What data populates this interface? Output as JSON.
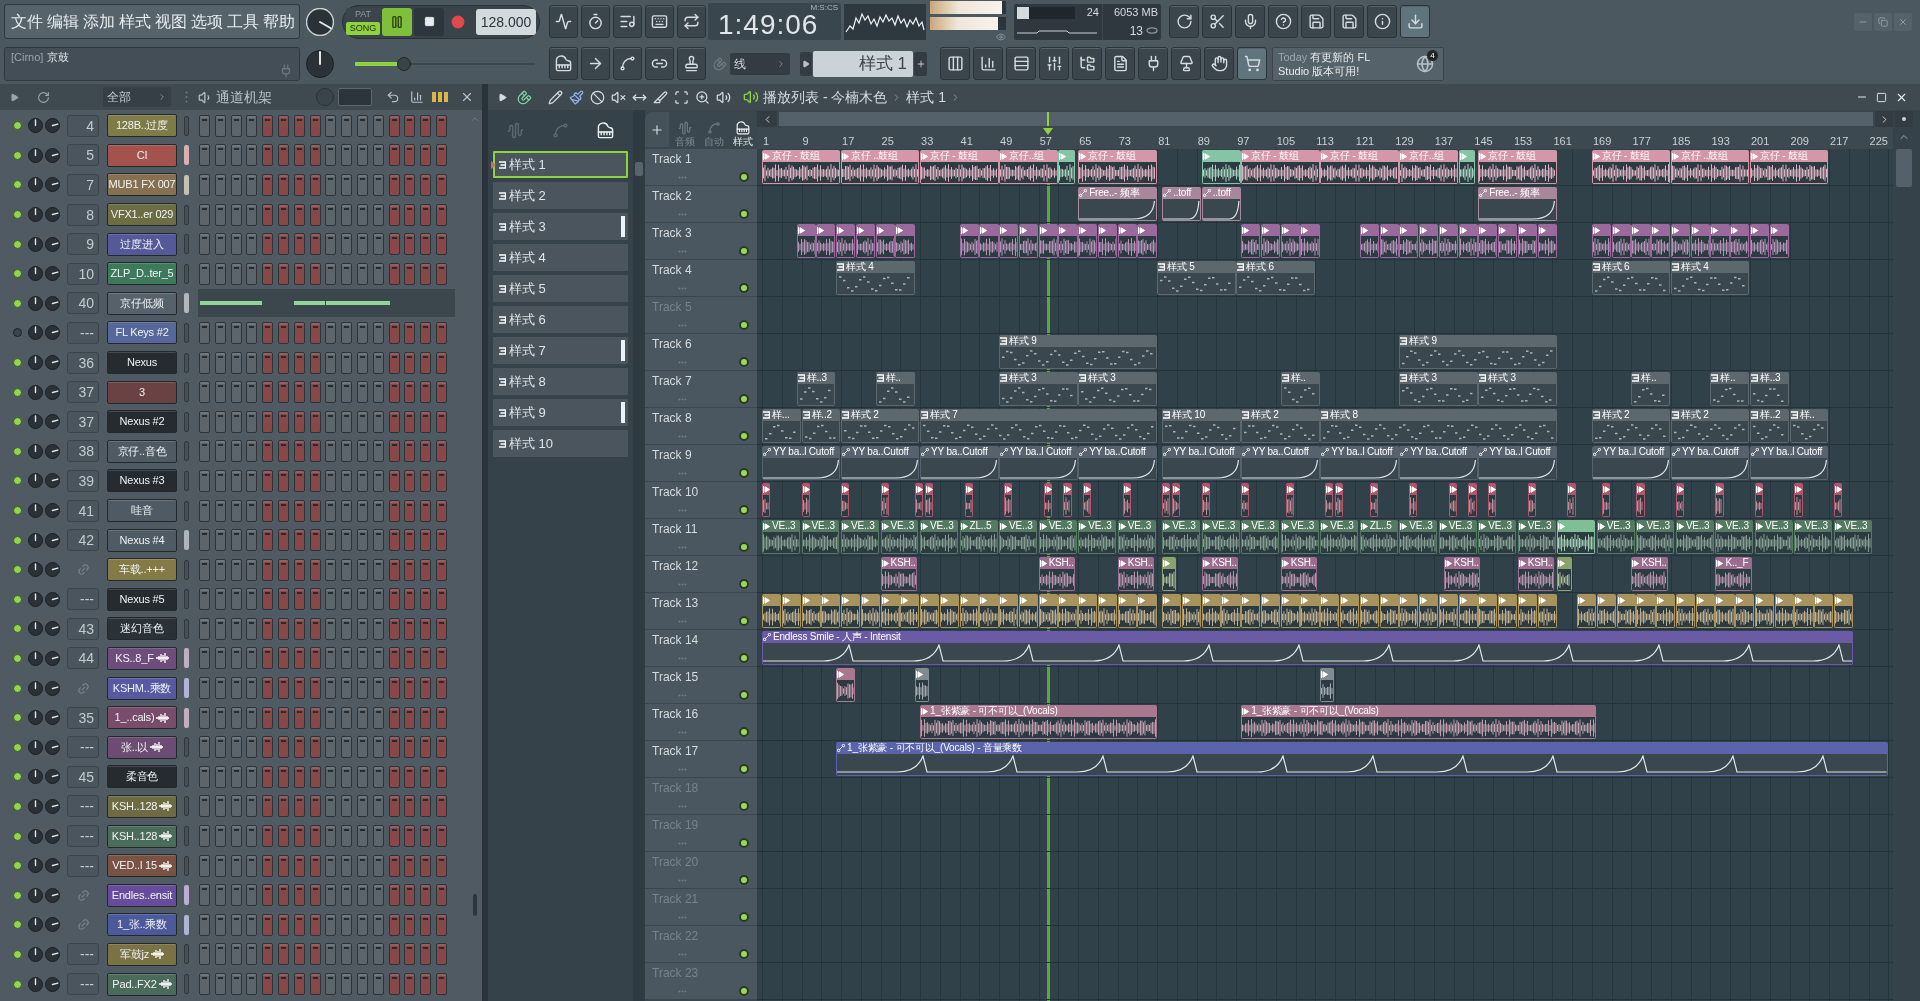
{
  "menu": [
    "文件",
    "编辑",
    "添加",
    "样式",
    "视图",
    "选项",
    "工具",
    "帮助"
  ],
  "hint": {
    "prefix": "[Cirno]",
    "text": "京鼓"
  },
  "song_position": {
    "level": 0.27
  },
  "transport": {
    "modes": [
      {
        "label": "PAT",
        "selected": false
      },
      {
        "label": "SONG",
        "selected": true
      }
    ],
    "playing": true,
    "tempo": "128.000"
  },
  "time": {
    "unit": "M:S:CS",
    "value": "1:49:06"
  },
  "peak_meters": [
    {
      "level": 0.95
    },
    {
      "level": 0.9
    }
  ],
  "cpu": {
    "level": 0.2,
    "reading": "24"
  },
  "memory": "6053 MB",
  "polyphony": "13",
  "snap": "线",
  "pattern_selector": "样式 1",
  "news": {
    "label": "Today",
    "message": "有更新的 FL Studio 版本可用!",
    "badge": "4"
  },
  "channel_rack": {
    "filter": "全部",
    "title": "通道机架",
    "channels": [
      {
        "enabled": true,
        "kind": "instrument",
        "mixer": "4",
        "name": "128B..过度",
        "color": "#7e7c46",
        "selected": false
      },
      {
        "enabled": true,
        "kind": "instrument",
        "mixer": "5",
        "name": "CI",
        "color": "#a4524c",
        "selected": true
      },
      {
        "enabled": true,
        "kind": "instrument",
        "mixer": "7",
        "name": "MUB1 FX 007",
        "color": "#85704f",
        "selected": true
      },
      {
        "enabled": true,
        "kind": "instrument",
        "mixer": "8",
        "name": "VFX1..er 029",
        "color": "#6c6d43",
        "selected": false
      },
      {
        "enabled": true,
        "kind": "instrument",
        "mixer": "9",
        "name": "过度进入",
        "color": "#55599a",
        "selected": false
      },
      {
        "enabled": true,
        "kind": "instrument",
        "mixer": "10",
        "name": "ZLP_D..ter_5",
        "color": "#3d7a5c",
        "selected": false
      },
      {
        "enabled": true,
        "kind": "pianoroll",
        "mixer": "40",
        "name": "京仔低频",
        "color": "#56626b",
        "selected": true
      },
      {
        "enabled": false,
        "kind": "instrument",
        "mixer": "---",
        "name": "FL Keys #2",
        "color": "#56679a",
        "selected": false
      },
      {
        "enabled": true,
        "kind": "instrument",
        "mixer": "36",
        "name": "Nexus",
        "color": "#262b2f",
        "selected": false
      },
      {
        "enabled": true,
        "kind": "instrument",
        "mixer": "37",
        "name": "3",
        "color": "#6a4244",
        "selected": false
      },
      {
        "enabled": true,
        "kind": "instrument",
        "mixer": "37",
        "name": "Nexus #2",
        "color": "#262b2f",
        "selected": false
      },
      {
        "enabled": true,
        "kind": "instrument",
        "mixer": "38",
        "name": "京仔..音色",
        "color": "#4f5b64",
        "selected": false
      },
      {
        "enabled": true,
        "kind": "instrument",
        "mixer": "39",
        "name": "Nexus #3",
        "color": "#262b2f",
        "selected": false
      },
      {
        "enabled": true,
        "kind": "instrument",
        "mixer": "41",
        "name": "哇音",
        "color": "#4f5b64",
        "selected": false
      },
      {
        "enabled": true,
        "kind": "instrument",
        "mixer": "42",
        "name": "Nexus #4",
        "color": "#4f5b64",
        "selected": true
      },
      {
        "enabled": true,
        "kind": "automation",
        "name": "车载..+++",
        "color": "#847a45",
        "selected": false
      },
      {
        "enabled": true,
        "kind": "instrument",
        "mixer": "---",
        "name": "Nexus #5",
        "color": "#262b2f",
        "selected": false
      },
      {
        "enabled": true,
        "kind": "instrument",
        "mixer": "43",
        "name": "迷幻音色",
        "color": "#2b3237",
        "selected": false
      },
      {
        "enabled": true,
        "kind": "audio",
        "mixer": "44",
        "name": "KS..8_F",
        "color": "#6e4c7c",
        "selected": true
      },
      {
        "enabled": true,
        "kind": "automation",
        "name": "KSHM..乘数",
        "color": "#5659a0",
        "selected": true
      },
      {
        "enabled": true,
        "kind": "audio",
        "mixer": "35",
        "name": "1_..cals)",
        "color": "#7a4c6c",
        "selected": true
      },
      {
        "enabled": true,
        "kind": "audio",
        "mixer": "---",
        "name": "张..以",
        "color": "#6c4c72",
        "selected": false
      },
      {
        "enabled": true,
        "kind": "instrument",
        "mixer": "45",
        "name": "柔音色",
        "color": "#262b2f",
        "selected": false
      },
      {
        "enabled": true,
        "kind": "audio",
        "mixer": "---",
        "name": "KSH..128",
        "color": "#6e6b42",
        "selected": false
      },
      {
        "enabled": true,
        "kind": "audio",
        "mixer": "---",
        "name": "KSH..128",
        "color": "#4b6b5b",
        "selected": false
      },
      {
        "enabled": true,
        "kind": "audio",
        "mixer": "---",
        "name": "VED..l 15",
        "color": "#7a5244",
        "selected": false
      },
      {
        "enabled": true,
        "kind": "automation",
        "name": "Endles..ensit",
        "color": "#684c9c",
        "selected": true
      },
      {
        "enabled": true,
        "kind": "automation",
        "name": "1_张..乘数",
        "color": "#4c5a9c",
        "selected": true
      },
      {
        "enabled": true,
        "kind": "audio",
        "mixer": "---",
        "name": "军鼓jz",
        "color": "#7a7244",
        "selected": false
      },
      {
        "enabled": true,
        "kind": "audio",
        "mixer": "---",
        "name": "Pad..FX2",
        "color": "#4b6b5a",
        "selected": false
      }
    ]
  },
  "playlist": {
    "title": "播放列表 - 今楠木色",
    "pattern": "样式 1",
    "filters": [
      {
        "label": "音频",
        "selected": false
      },
      {
        "label": "自动",
        "selected": false
      },
      {
        "label": "样式",
        "selected": true
      }
    ],
    "patterns": [
      {
        "label": "样式 1",
        "selected": true,
        "highlighted": false
      },
      {
        "label": "样式 2",
        "selected": false,
        "highlighted": false
      },
      {
        "label": "样式 3",
        "selected": false,
        "highlighted": true
      },
      {
        "label": "样式 4",
        "selected": false,
        "highlighted": false
      },
      {
        "label": "样式 5",
        "selected": false,
        "highlighted": false
      },
      {
        "label": "样式 6",
        "selected": false,
        "highlighted": false
      },
      {
        "label": "样式 7",
        "selected": false,
        "highlighted": true
      },
      {
        "label": "样式 8",
        "selected": false,
        "highlighted": false
      },
      {
        "label": "样式 9",
        "selected": false,
        "highlighted": true
      },
      {
        "label": "样式 10",
        "selected": false,
        "highlighted": false
      }
    ],
    "ruler": [
      "1",
      "9",
      "17",
      "25",
      "33",
      "41",
      "49",
      "57",
      "65",
      "73",
      "81",
      "89",
      "97",
      "105",
      "113",
      "121",
      "129",
      "137",
      "145",
      "153",
      "161",
      "169",
      "177",
      "185",
      "193",
      "201",
      "209",
      "217",
      "225"
    ],
    "tracks": [
      {
        "name": "Track 1",
        "empty": false,
        "color": "#d497aa",
        "clips": [
          {
            "kind": "audio",
            "label": "京仔 - 鼓组"
          },
          {
            "kind": "audio",
            "label": "京仔 ..鼓组"
          },
          {
            "kind": "audio",
            "label": "京仔 - 鼓组"
          },
          {
            "kind": "audio",
            "label": "京仔..组"
          },
          {
            "kind": "audio",
            "color": "#86c4a6"
          },
          {
            "kind": "audio",
            "label": "京仔 - 鼓组"
          },
          {
            "kind": "audio",
            "color": "#86c4a6"
          },
          {
            "kind": "audio",
            "label": "京仔 - 鼓组"
          },
          {
            "kind": "audio",
            "label": "京仔 - 鼓组"
          },
          {
            "kind": "audio",
            "label": "京仔..组"
          },
          {
            "kind": "audio",
            "color": "#86c4a6"
          },
          {
            "kind": "audio",
            "label": "京仔 - 鼓组"
          },
          {
            "kind": "audio",
            "label": "京仔 - 鼓组"
          },
          {
            "kind": "audio",
            "label": "京仔 ..鼓组"
          },
          {
            "kind": "audio",
            "label": "京仔 - 鼓组"
          }
        ]
      },
      {
        "name": "Track 2",
        "empty": false,
        "color": "#a8879c",
        "clips": [
          {
            "kind": "automation",
            "label": "Free..- 频率"
          },
          {
            "kind": "automation",
            "label": "..toff"
          },
          {
            "kind": "automation",
            "label": "..toff"
          },
          {
            "kind": "automation",
            "label": "Free..- 频率"
          }
        ]
      },
      {
        "name": "Track 3",
        "empty": false,
        "color": "#9a6a9c",
        "clips": [
          {
            "kind": "audio"
          },
          {
            "kind": "audio"
          },
          {
            "kind": "audio"
          },
          {
            "kind": "audio"
          },
          {
            "kind": "audio"
          },
          {
            "kind": "audio"
          },
          {
            "kind": "audio"
          },
          {
            "kind": "audio"
          },
          {
            "kind": "audio"
          },
          {
            "kind": "audio"
          },
          {
            "kind": "audio"
          },
          {
            "kind": "audio"
          },
          {
            "kind": "audio"
          },
          {
            "kind": "audio"
          },
          {
            "kind": "audio"
          },
          {
            "kind": "audio"
          },
          {
            "kind": "audio"
          },
          {
            "kind": "audio"
          },
          {
            "kind": "audio"
          },
          {
            "kind": "audio"
          },
          {
            "kind": "audio"
          },
          {
            "kind": "audio"
          },
          {
            "kind": "audio"
          },
          {
            "kind": "audio"
          },
          {
            "kind": "audio"
          },
          {
            "kind": "audio"
          },
          {
            "kind": "audio"
          },
          {
            "kind": "audio"
          },
          {
            "kind": "audio"
          },
          {
            "kind": "audio"
          },
          {
            "kind": "audio"
          },
          {
            "kind": "audio"
          },
          {
            "kind": "audio"
          },
          {
            "kind": "audio"
          },
          {
            "kind": "audio"
          },
          {
            "kind": "audio"
          },
          {
            "kind": "audio"
          },
          {
            "kind": "audio"
          },
          {
            "kind": "audio"
          },
          {
            "kind": "audio"
          }
        ]
      },
      {
        "name": "Track 4",
        "empty": false,
        "color": "#5c676e",
        "clips": [
          {
            "kind": "pattern",
            "label": "样式 4"
          },
          {
            "kind": "pattern",
            "label": "样式 5"
          },
          {
            "kind": "pattern",
            "label": "样式 6"
          },
          {
            "kind": "pattern",
            "label": "样式 6"
          },
          {
            "kind": "pattern",
            "label": "样式 4"
          }
        ]
      },
      {
        "name": "Track 5",
        "empty": true
      },
      {
        "name": "Track 6",
        "empty": false,
        "color": "#5c676e",
        "clips": [
          {
            "kind": "pattern",
            "label": "样式 9"
          },
          {
            "kind": "pattern",
            "label": "样式 9"
          }
        ]
      },
      {
        "name": "Track 7",
        "empty": false,
        "color": "#5c676e",
        "clips": [
          {
            "kind": "pattern",
            "label": "样..3"
          },
          {
            "kind": "pattern",
            "label": "样.."
          },
          {
            "kind": "pattern",
            "label": "样式 3"
          },
          {
            "kind": "pattern",
            "label": "样式 3"
          },
          {
            "kind": "pattern",
            "label": "样.."
          },
          {
            "kind": "pattern",
            "label": "样式 3"
          },
          {
            "kind": "pattern",
            "label": "样式 3"
          },
          {
            "kind": "pattern",
            "label": "样.."
          },
          {
            "kind": "pattern",
            "label": "样.."
          },
          {
            "kind": "pattern",
            "label": "样..3"
          }
        ]
      },
      {
        "name": "Track 8",
        "empty": false,
        "color": "#5c676e",
        "clips": [
          {
            "kind": "pattern",
            "label": "样..."
          },
          {
            "kind": "pattern",
            "label": "样..2"
          },
          {
            "kind": "pattern",
            "label": "样式 2"
          },
          {
            "kind": "pattern",
            "label": "样式 7"
          },
          {
            "kind": "pattern",
            "label": "样式 10"
          },
          {
            "kind": "pattern",
            "label": "样式 2"
          },
          {
            "kind": "pattern",
            "label": "样式 8"
          },
          {
            "kind": "pattern",
            "label": "样式 2"
          },
          {
            "kind": "pattern",
            "label": "样式 2"
          },
          {
            "kind": "pattern",
            "label": "样..2"
          },
          {
            "kind": "pattern",
            "label": "样.."
          }
        ]
      },
      {
        "name": "Track 9",
        "empty": false,
        "color": "#56636e",
        "clips": [
          {
            "kind": "automation",
            "label": "YY ba..l Cutoff"
          },
          {
            "kind": "automation",
            "label": "YY ba..Cutoff"
          },
          {
            "kind": "automation",
            "label": "YY ba..Cutoff"
          },
          {
            "kind": "automation",
            "label": "YY ba..l Cutoff"
          },
          {
            "kind": "automation",
            "label": "YY ba..Cutoff"
          },
          {
            "kind": "automation",
            "label": "YY ba..l Cutoff"
          },
          {
            "kind": "automation",
            "label": "YY ba..Cutoff"
          },
          {
            "kind": "automation",
            "label": "YY ba..l Cutoff"
          },
          {
            "kind": "automation",
            "label": "YY ba..Cutoff"
          },
          {
            "kind": "automation",
            "label": "YY ba..l Cutoff"
          },
          {
            "kind": "automation",
            "label": "YY ba..l Cutoff"
          },
          {
            "kind": "automation",
            "label": "YY ba..Cutoff"
          },
          {
            "kind": "automation",
            "label": "YY ba..l Cutoff"
          }
        ]
      },
      {
        "name": "Track 10",
        "empty": false,
        "color": "#b0566a",
        "clips": [
          {
            "kind": "audio"
          },
          {
            "kind": "audio"
          },
          {
            "kind": "audio"
          },
          {
            "kind": "audio"
          },
          {
            "kind": "audio"
          },
          {
            "kind": "audio"
          },
          {
            "kind": "audio"
          },
          {
            "kind": "audio"
          },
          {
            "kind": "audio"
          },
          {
            "kind": "audio"
          },
          {
            "kind": "audio"
          },
          {
            "kind": "audio"
          },
          {
            "kind": "audio"
          },
          {
            "kind": "audio"
          },
          {
            "kind": "audio"
          },
          {
            "kind": "audio"
          },
          {
            "kind": "audio"
          },
          {
            "kind": "audio"
          },
          {
            "kind": "audio"
          },
          {
            "kind": "audio"
          },
          {
            "kind": "audio"
          },
          {
            "kind": "audio"
          },
          {
            "kind": "audio"
          },
          {
            "kind": "audio"
          },
          {
            "kind": "audio"
          },
          {
            "kind": "audio"
          },
          {
            "kind": "audio"
          },
          {
            "kind": "audio"
          },
          {
            "kind": "audio"
          },
          {
            "kind": "audio"
          },
          {
            "kind": "audio"
          },
          {
            "kind": "audio"
          },
          {
            "kind": "audio"
          }
        ]
      },
      {
        "name": "Track 11",
        "empty": false,
        "color": "#557a62",
        "clips": [
          {
            "kind": "audio",
            "label": "VE..3"
          },
          {
            "kind": "audio",
            "label": "VE..3"
          },
          {
            "kind": "audio",
            "label": "VE..3"
          },
          {
            "kind": "audio",
            "label": "VE..3"
          },
          {
            "kind": "audio",
            "label": "VE..3"
          },
          {
            "kind": "audio",
            "label": "ZL..5"
          },
          {
            "kind": "audio",
            "label": "VE..3"
          },
          {
            "kind": "audio",
            "label": "VE..3"
          },
          {
            "kind": "audio",
            "label": "VE..3"
          },
          {
            "kind": "audio",
            "label": "VE..3"
          },
          {
            "kind": "audio",
            "label": "VE..3"
          },
          {
            "kind": "audio",
            "label": "VE..3"
          },
          {
            "kind": "audio",
            "label": "VE..3"
          },
          {
            "kind": "audio",
            "label": "VE..3"
          },
          {
            "kind": "audio",
            "label": "VE..3"
          },
          {
            "kind": "audio",
            "label": "ZL..5"
          },
          {
            "kind": "audio",
            "label": "VE..3"
          },
          {
            "kind": "audio",
            "label": "VE..3"
          },
          {
            "kind": "audio",
            "label": "VE..3"
          },
          {
            "kind": "audio",
            "label": "VE..3"
          },
          {
            "kind": "audio",
            "color": "#7fbf95"
          },
          {
            "kind": "audio",
            "label": "VE..3"
          },
          {
            "kind": "audio",
            "label": "VE..3"
          },
          {
            "kind": "audio",
            "label": "VE..3"
          },
          {
            "kind": "audio",
            "label": "VE..3"
          },
          {
            "kind": "audio",
            "label": "VE..3"
          },
          {
            "kind": "audio",
            "label": "VE..3"
          },
          {
            "kind": "audio",
            "label": "VE..3"
          }
        ]
      },
      {
        "name": "Track 12",
        "empty": false,
        "color": "#9c6b90",
        "clips": [
          {
            "kind": "audio",
            "label": "KSH.."
          },
          {
            "kind": "audio",
            "label": "KSH.."
          },
          {
            "kind": "audio",
            "label": "KSH.."
          },
          {
            "kind": "audio",
            "color": "#8aa36c"
          },
          {
            "kind": "audio",
            "label": "KSH.."
          },
          {
            "kind": "audio",
            "label": "KSH.."
          },
          {
            "kind": "audio",
            "label": "KSH.."
          },
          {
            "kind": "audio",
            "label": "KSH.."
          },
          {
            "kind": "audio",
            "color": "#8aa36c"
          },
          {
            "kind": "audio",
            "label": "KSH.."
          },
          {
            "kind": "audio",
            "label": "K.._F"
          }
        ]
      },
      {
        "name": "Track 13",
        "empty": false,
        "color": "#a8935f",
        "clips": [
          {
            "kind": "audio"
          },
          {
            "kind": "audio"
          },
          {
            "kind": "audio"
          },
          {
            "kind": "audio"
          },
          {
            "kind": "audio"
          },
          {
            "kind": "audio"
          },
          {
            "kind": "audio"
          },
          {
            "kind": "audio"
          },
          {
            "kind": "audio"
          },
          {
            "kind": "audio"
          },
          {
            "kind": "audio"
          },
          {
            "kind": "audio"
          },
          {
            "kind": "audio"
          },
          {
            "kind": "audio"
          },
          {
            "kind": "audio"
          },
          {
            "kind": "audio"
          },
          {
            "kind": "audio"
          },
          {
            "kind": "audio"
          },
          {
            "kind": "audio"
          },
          {
            "kind": "audio"
          },
          {
            "kind": "audio"
          },
          {
            "kind": "audio"
          },
          {
            "kind": "audio"
          },
          {
            "kind": "audio"
          },
          {
            "kind": "audio"
          },
          {
            "kind": "audio"
          },
          {
            "kind": "audio"
          },
          {
            "kind": "audio"
          },
          {
            "kind": "audio"
          },
          {
            "kind": "audio"
          },
          {
            "kind": "audio"
          },
          {
            "kind": "audio"
          },
          {
            "kind": "audio"
          },
          {
            "kind": "audio"
          },
          {
            "kind": "audio"
          },
          {
            "kind": "audio"
          },
          {
            "kind": "audio"
          },
          {
            "kind": "audio"
          },
          {
            "kind": "audio"
          },
          {
            "kind": "audio"
          },
          {
            "kind": "audio"
          },
          {
            "kind": "audio"
          },
          {
            "kind": "audio"
          },
          {
            "kind": "audio"
          },
          {
            "kind": "audio"
          },
          {
            "kind": "audio"
          },
          {
            "kind": "audio"
          },
          {
            "kind": "audio"
          },
          {
            "kind": "audio"
          },
          {
            "kind": "audio"
          },
          {
            "kind": "audio"
          },
          {
            "kind": "audio"
          },
          {
            "kind": "audio"
          },
          {
            "kind": "audio"
          }
        ]
      },
      {
        "name": "Track 14",
        "empty": false,
        "color": "#6b5ba6",
        "clips": [
          {
            "kind": "automation",
            "label": "Endless Smile - 人声 - Intensit"
          }
        ]
      },
      {
        "name": "Track 15",
        "empty": false,
        "color": "#a9788f",
        "clips": [
          {
            "kind": "audio"
          },
          {
            "kind": "audio",
            "color": "#7f8a92"
          },
          {
            "kind": "audio",
            "color": "#7f8a92"
          }
        ]
      },
      {
        "name": "Track 16",
        "empty": false,
        "color": "#a9788f",
        "clips": [
          {
            "kind": "audio",
            "label": "1_张紫豪 - 可不可以_(Vocals)"
          },
          {
            "kind": "audio",
            "label": "1_张紫豪 - 可不可以_(Vocals)"
          }
        ]
      },
      {
        "name": "Track 17",
        "empty": false,
        "color": "#5b64aa",
        "clips": [
          {
            "kind": "automation",
            "label": "1_张紫豪 - 可不可以_(Vocals) - 音量乘数"
          }
        ]
      },
      {
        "name": "Track 18",
        "empty": true
      },
      {
        "name": "Track 19",
        "empty": true
      },
      {
        "name": "Track 20",
        "empty": true
      },
      {
        "name": "Track 21",
        "empty": true
      },
      {
        "name": "Track 22",
        "empty": true
      },
      {
        "name": "Track 23",
        "empty": true
      }
    ]
  }
}
